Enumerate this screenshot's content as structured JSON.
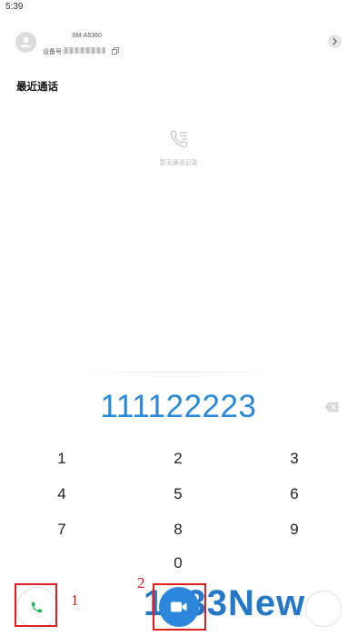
{
  "status_bar": {
    "time": "5:39"
  },
  "device": {
    "model": "SM-A5360",
    "id_label": "设备号:"
  },
  "recent_calls": {
    "title": "最近通话",
    "empty_text": "暂无通话记录"
  },
  "dial_number": "111122223",
  "keypad": [
    "1",
    "2",
    "3",
    "4",
    "5",
    "6",
    "7",
    "8",
    "9",
    "0"
  ],
  "annotations": [
    "1",
    "2"
  ],
  "watermark": "1233News",
  "colors": {
    "accent": "#2a88d8",
    "call_green": "#20b45a",
    "annotation_red": "#e02020"
  },
  "icons": [
    "avatar-icon",
    "copy-icon",
    "chevron-right-icon",
    "call-log-icon",
    "backspace-icon",
    "phone-icon",
    "video-icon"
  ]
}
